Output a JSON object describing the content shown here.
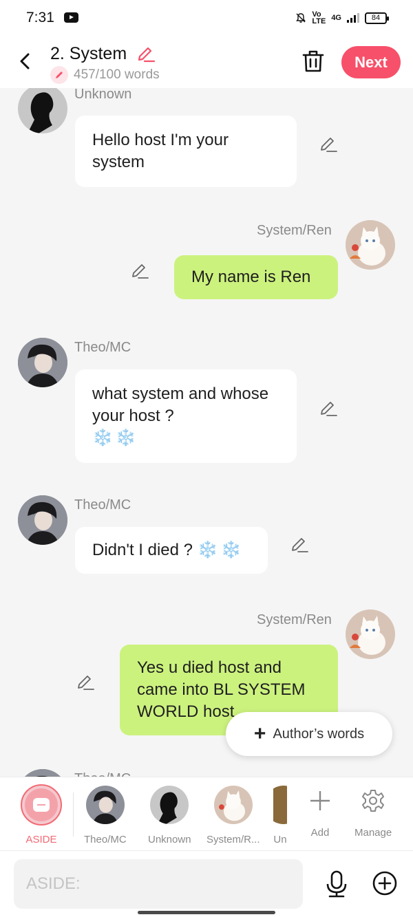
{
  "status_bar": {
    "time": "7:31",
    "volte_top": "Vo",
    "volte_bottom": "LTE",
    "network": "4G",
    "battery": "84"
  },
  "header": {
    "title": "2. System",
    "word_count": "457/100 words",
    "next_label": "Next"
  },
  "messages": [
    {
      "speaker": "Unknown",
      "text": "Hello host I'm your system",
      "side": "left"
    },
    {
      "speaker": "System/Ren",
      "text": "My name is Ren",
      "side": "right"
    },
    {
      "speaker": "Theo/MC",
      "text": "what system and whose your host ?",
      "emoji": "❄️❄️",
      "side": "left"
    },
    {
      "speaker": "Theo/MC",
      "text": "Didn't I died ?",
      "emoji": "❄️❄️",
      "side": "left"
    },
    {
      "speaker": "System/Ren",
      "text": "Yes u died host and came into BL SYSTEM WORLD host",
      "side": "right"
    },
    {
      "speaker": "Theo/MC",
      "text": "",
      "side": "left"
    }
  ],
  "author_words_label": "Author’s words",
  "character_bar": {
    "items": [
      {
        "label": "ASIDE",
        "selected": true
      },
      {
        "label": "Theo/MC"
      },
      {
        "label": "Unknown"
      },
      {
        "label": "System/R..."
      },
      {
        "label": "Un"
      }
    ],
    "add_label": "Add",
    "manage_label": "Manage"
  },
  "input": {
    "placeholder": "ASIDE:"
  },
  "colors": {
    "accent": "#f7506a",
    "bubble_right": "#ccf27e",
    "bubble_left": "#ffffff",
    "background": "#f5f5f5"
  },
  "icons": [
    "back-arrow-icon",
    "pencil-icon",
    "trash-icon",
    "plus-icon",
    "gear-icon",
    "microphone-icon",
    "add-circle-icon",
    "youtube-icon",
    "bell-off-icon",
    "battery-icon"
  ]
}
